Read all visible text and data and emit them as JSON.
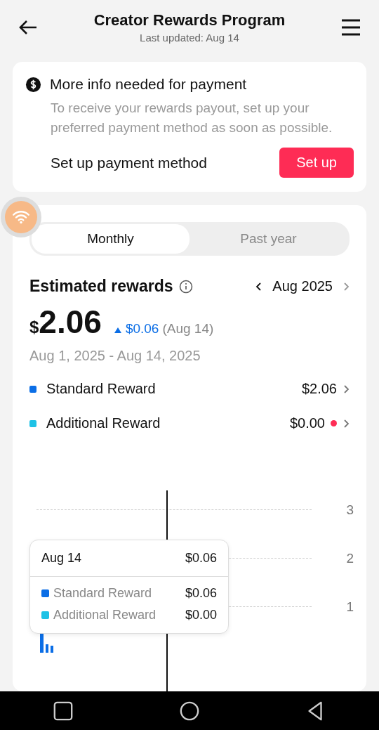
{
  "header": {
    "title": "Creator Rewards Program",
    "subtitle": "Last updated: Aug 14"
  },
  "notice": {
    "title": "More info needed for payment",
    "body": "To receive your rewards payout, set up your preferred payment method as soon as possible.",
    "action_label": "Set up payment method",
    "button": "Set up"
  },
  "tabs": [
    {
      "label": "Monthly",
      "selected": true
    },
    {
      "label": "Past year",
      "selected": false
    }
  ],
  "rewards": {
    "title": "Estimated rewards",
    "month": "Aug 2025",
    "currency": "$",
    "amount": "2.06",
    "change": "$0.06",
    "change_date": "(Aug 14)",
    "range": "Aug 1, 2025 - Aug 14, 2025"
  },
  "breakdown": [
    {
      "name": "Standard Reward",
      "value": "$2.06",
      "color": "#0b6ee6",
      "alert": false
    },
    {
      "name": "Additional Reward",
      "value": "$0.00",
      "color": "#1ec2e6",
      "alert": true
    }
  ],
  "chart": {
    "y_labels": [
      "3",
      "2",
      "1"
    ]
  },
  "tooltip": {
    "date": "Aug 14",
    "total": "$0.06",
    "rows": [
      {
        "name": "Standard Reward",
        "value": "$0.06",
        "color": "#0b6ee6"
      },
      {
        "name": "Additional Reward",
        "value": "$0.00",
        "color": "#1ec2e6"
      }
    ]
  }
}
